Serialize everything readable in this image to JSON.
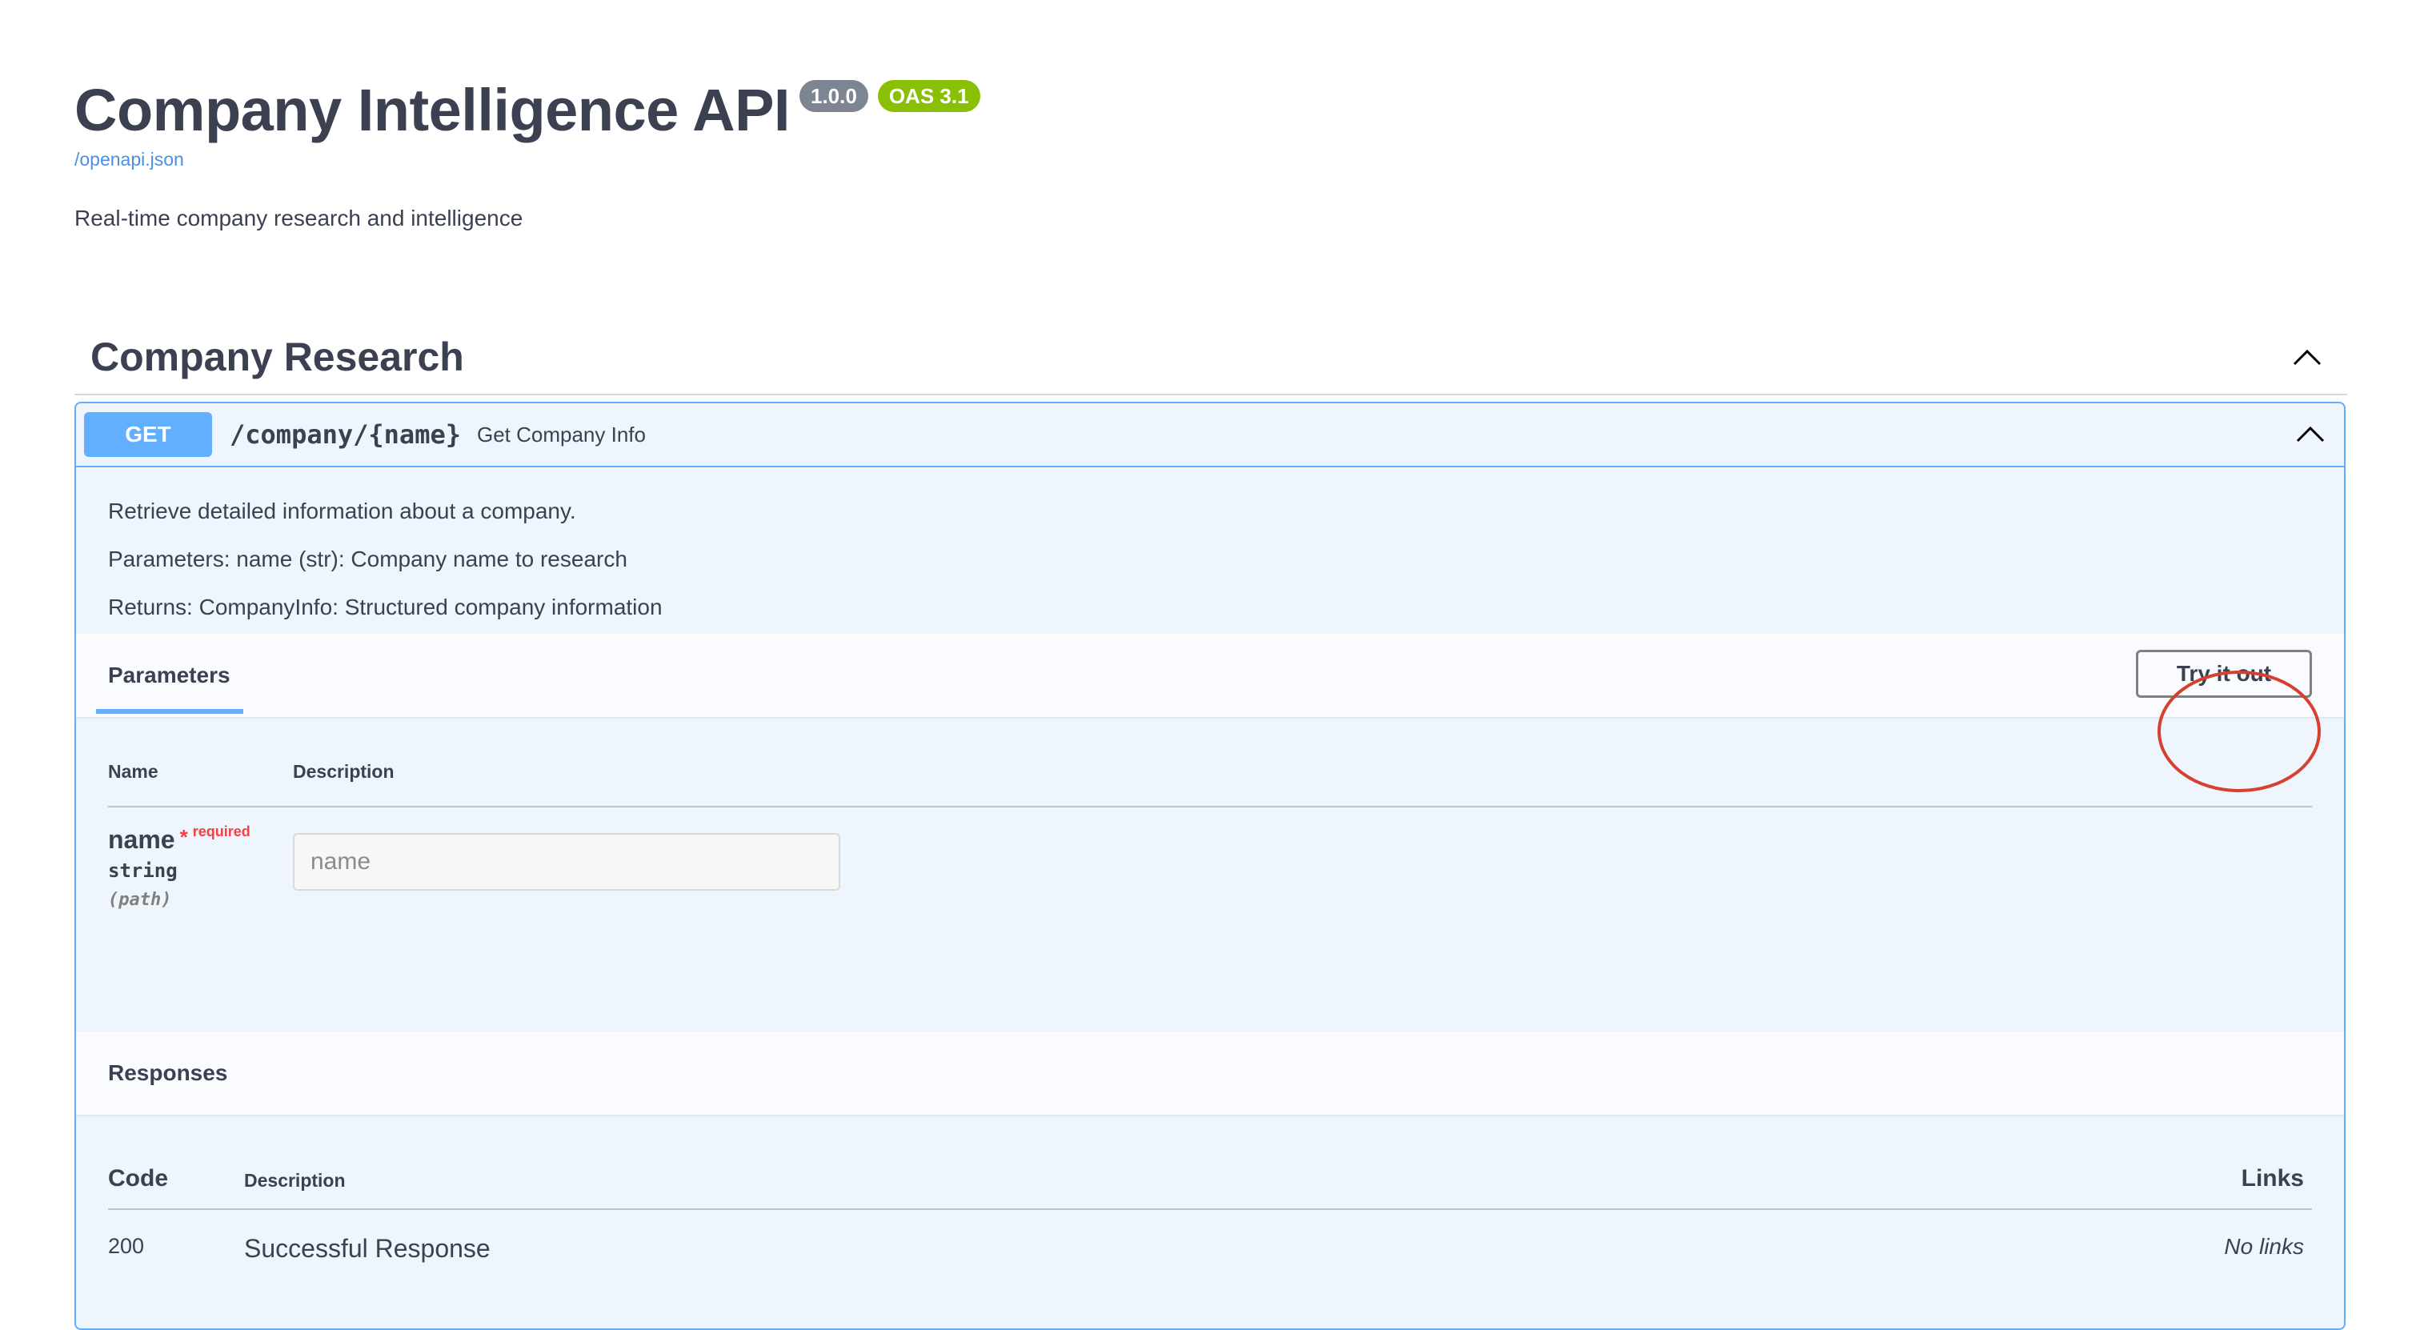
{
  "info": {
    "title": "Company Intelligence API",
    "version": "1.0.0",
    "oas": "OAS 3.1",
    "spec_link": "/openapi.json",
    "description": "Real-time company research and intelligence"
  },
  "tag": {
    "title": "Company Research",
    "collapse_icon": "chevron-up-icon"
  },
  "operation": {
    "method": "GET",
    "path": "/company/{name}",
    "summary": "Get Company Info",
    "collapse_icon": "chevron-up-icon",
    "description_lines": [
      "Retrieve detailed information about a company.",
      "Parameters: name (str): Company name to research",
      "Returns: CompanyInfo: Structured company information"
    ]
  },
  "parameters_section": {
    "tab_label": "Parameters",
    "try_button_label": "Try it out",
    "columns": {
      "name": "Name",
      "description": "Description"
    },
    "params": [
      {
        "name": "name",
        "required_star": "*",
        "required_label": "required",
        "type": "string",
        "in": "(path)",
        "placeholder": "name"
      }
    ]
  },
  "responses_section": {
    "title": "Responses",
    "columns": {
      "code": "Code",
      "description": "Description",
      "links": "Links"
    },
    "rows": [
      {
        "code": "200",
        "description": "Successful Response",
        "links": "No links"
      }
    ]
  },
  "colors": {
    "get_method": "#61affe",
    "version_badge": "#7d8492",
    "oas_badge": "#89bf04",
    "required": "#f93e3e",
    "highlight_circle": "#d6412f"
  }
}
